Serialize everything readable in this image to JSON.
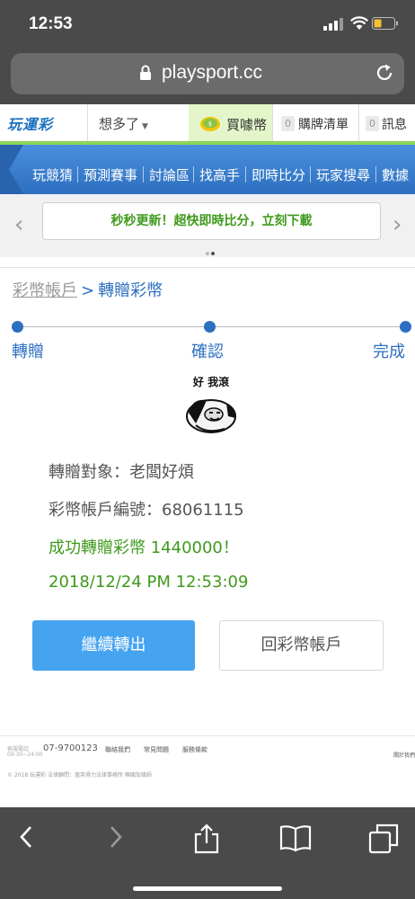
{
  "status_bar": {
    "time": "12:53"
  },
  "browser": {
    "url": "playsport.cc"
  },
  "header": {
    "logo_text": "玩運彩",
    "more_label": "想多了",
    "buy_label": "買噱幣",
    "cart_count": "0",
    "cart_label": "購牌清單",
    "msg_count": "0",
    "msg_label": "訊息"
  },
  "nav": {
    "items": [
      "玩競猜",
      "預測賽事",
      "討論區",
      "找高手",
      "即時比分",
      "玩家搜尋",
      "數據"
    ]
  },
  "banner": {
    "text": "秒秒更新！超快即時比分，立刻下載"
  },
  "breadcrumb": {
    "parent": "彩幣帳戶",
    "separator": ">",
    "current": "轉贈彩幣"
  },
  "steps": [
    "轉贈",
    "確認",
    "完成"
  ],
  "meme": {
    "caption": "好 我滾"
  },
  "result": {
    "target": "轉贈對象：老闆好煩",
    "account": "彩幣帳戶編號：68061115",
    "success": "成功轉贈彩幣 1440000！",
    "timestamp": "2018/12/24 PM 12:53:09"
  },
  "buttons": {
    "continue": "繼續轉出",
    "back": "回彩幣帳戶"
  },
  "footer": {
    "service_label": "客服電話",
    "hours": "09:30~24:00",
    "phone": "07-9700123",
    "links": [
      "聯絡我們",
      "常見問題",
      "服務條款"
    ],
    "right_link": "關於我們",
    "copyright": "© 2018 玩運彩 法律顧問：滙英得力法律事務所 陳國加律師"
  },
  "colors": {
    "accent": "#2d6fc0",
    "success": "#3f9a1c",
    "primary_button": "#45a3f0",
    "buy_bg": "#e4f6c9"
  }
}
